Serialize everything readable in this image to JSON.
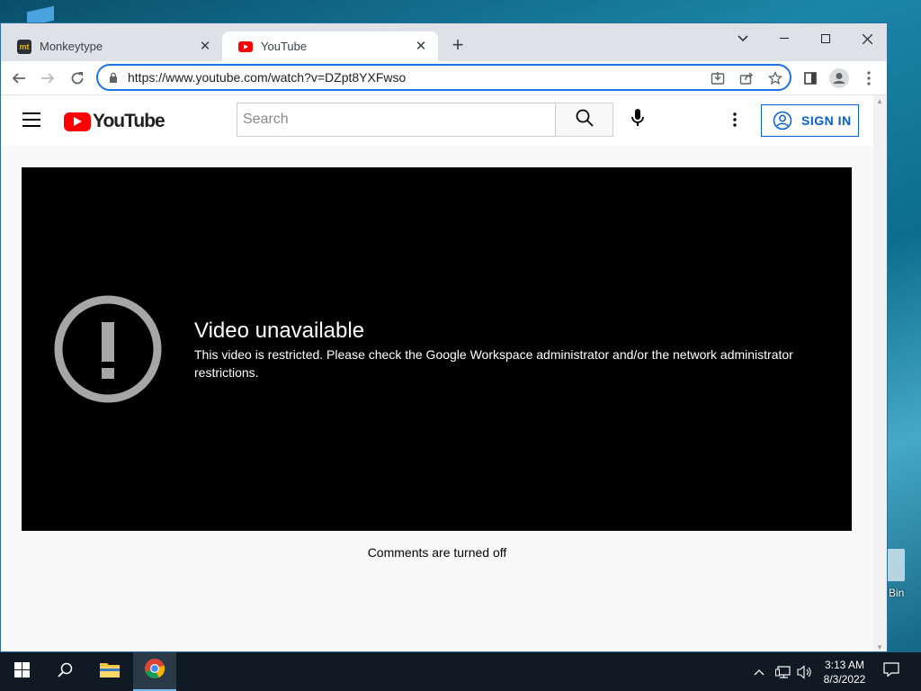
{
  "desktop": {
    "recycle_bin_label": "Bin"
  },
  "browser": {
    "tabs": [
      {
        "title": "Monkeytype",
        "favicon": "monkeytype-icon",
        "active": false
      },
      {
        "title": "YouTube",
        "favicon": "youtube-icon",
        "active": true
      }
    ],
    "url": "https://www.youtube.com/watch?v=DZpt8YXFwso"
  },
  "youtube": {
    "logo_text": "YouTube",
    "search_placeholder": "Search",
    "sign_in_label": "SIGN IN",
    "error_title": "Video unavailable",
    "error_message": "This video is restricted. Please check the Google Workspace administrator and/or the network administrator restrictions.",
    "comments_status": "Comments are turned off"
  },
  "taskbar": {
    "time": "3:13 AM",
    "date": "8/3/2022"
  },
  "colors": {
    "youtube_red": "#ff0000",
    "link_blue": "#065fd4",
    "omnibox_focus": "#1a73e8"
  }
}
